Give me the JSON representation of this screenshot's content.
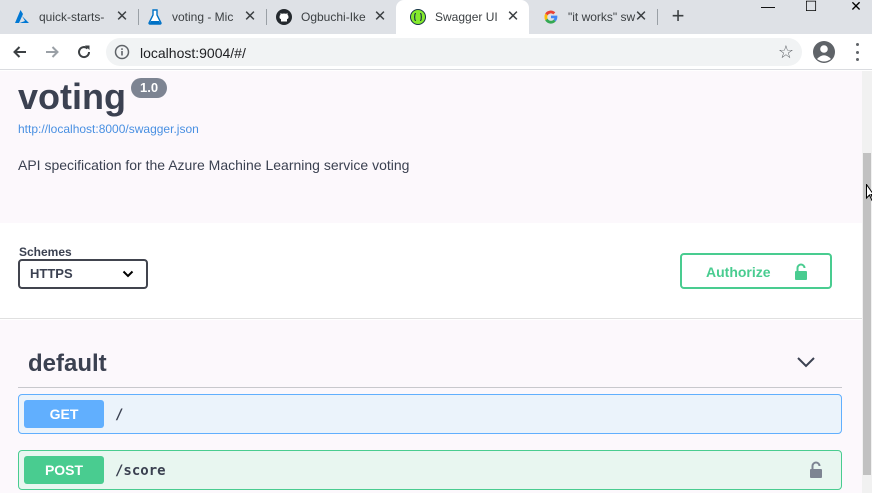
{
  "browser": {
    "tabs": [
      {
        "title": "quick-starts-",
        "icon": "azure-icon",
        "close": "✕"
      },
      {
        "title": "voting - Mic",
        "icon": "azure-ml-icon",
        "close": "✕"
      },
      {
        "title": "Ogbuchi-Ike",
        "icon": "github-icon",
        "close": "✕"
      },
      {
        "title": "Swagger UI",
        "icon": "swagger-icon",
        "close": "✕",
        "active": true
      },
      {
        "title": "\"it works\" sw",
        "icon": "google-icon",
        "close": "✕"
      }
    ],
    "new_tab": "+",
    "window_controls": {
      "minimize": "—",
      "maximize": "☐",
      "close": "✕"
    },
    "url": "localhost:9004/#/",
    "bookmark_icon": "☆"
  },
  "info": {
    "title": "voting",
    "version": "1.0",
    "spec_url": "http://localhost:8000/swagger.json",
    "description": "API specification for the Azure Machine Learning service voting"
  },
  "schemes": {
    "label": "Schemes",
    "selected": "HTTPS"
  },
  "authorize": {
    "label": "Authorize"
  },
  "tag": {
    "name": "default",
    "operations": [
      {
        "method": "GET",
        "path": "/",
        "color": "#61affe"
      },
      {
        "method": "POST",
        "path": "/score",
        "color": "#49cc90"
      }
    ]
  },
  "colors": {
    "accent_green": "#49cc90",
    "accent_blue": "#61affe",
    "text": "#3b4151",
    "link": "#4990e2"
  }
}
